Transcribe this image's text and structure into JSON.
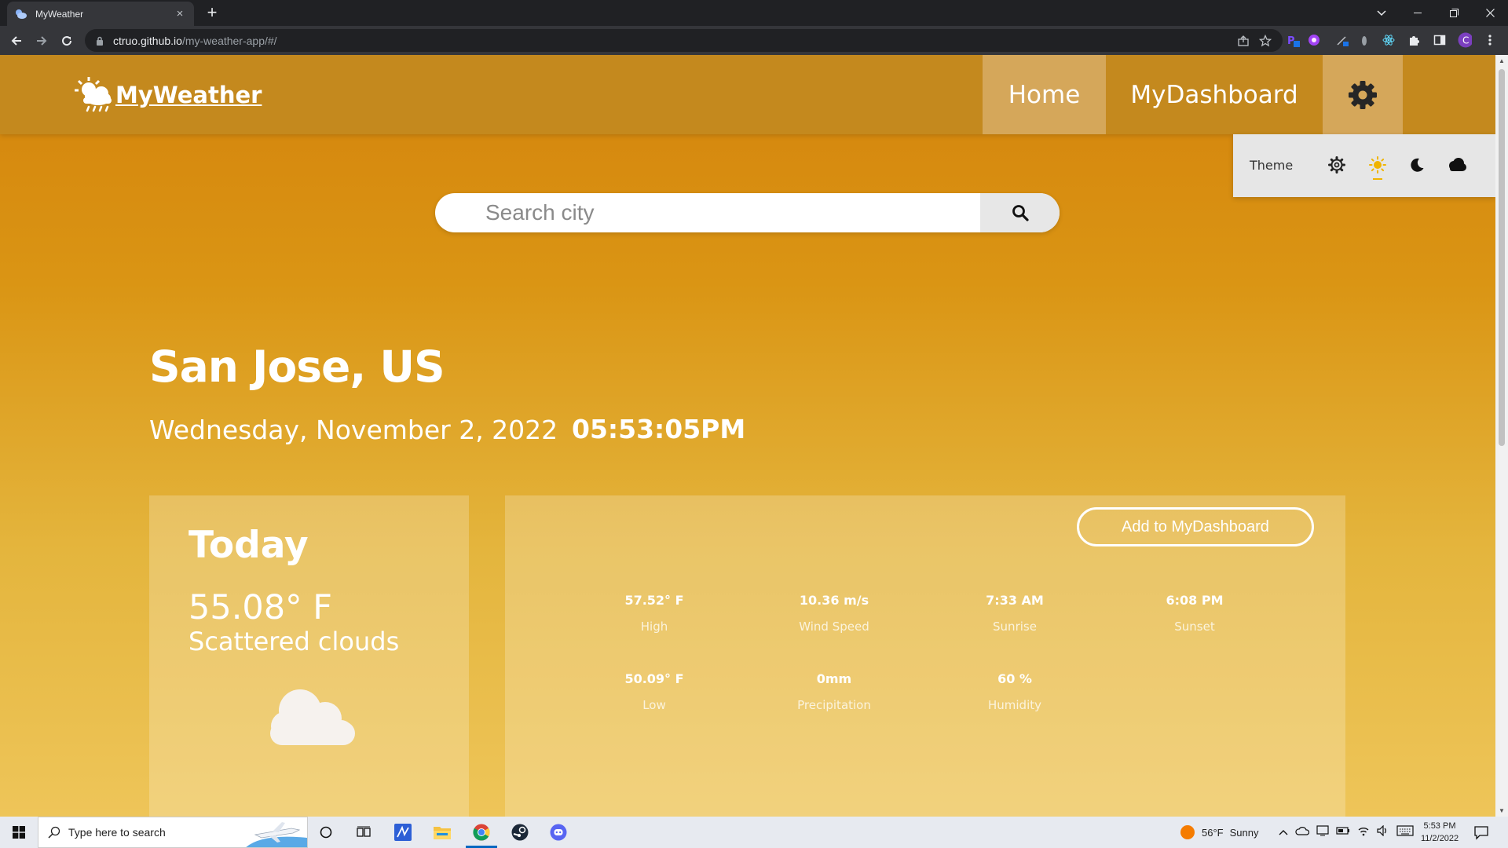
{
  "browser": {
    "tab_title": "MyWeather",
    "tab_close": "×",
    "new_tab": "+",
    "url_host": "ctruo.github.io",
    "url_path": "/my-weather-app/#/"
  },
  "app": {
    "brand": "MyWeather",
    "nav": {
      "home": "Home",
      "dashboard": "MyDashboard"
    },
    "theme": {
      "label": "Theme",
      "selected": "light"
    },
    "search": {
      "placeholder": "Search city",
      "value": ""
    },
    "location": {
      "city": "San Jose, US",
      "date": "Wednesday, November 2, 2022",
      "time": "05:53:05PM"
    },
    "today": {
      "title": "Today",
      "temperature": "55.08° F",
      "description": "Scattered clouds",
      "icon": "cloud-icon"
    },
    "add_button": "Add to MyDashboard",
    "stats": [
      {
        "value": "57.52° F",
        "label": "High"
      },
      {
        "value": "10.36 m/s",
        "label": "Wind Speed"
      },
      {
        "value": "7:33 AM",
        "label": "Sunrise"
      },
      {
        "value": "6:08 PM",
        "label": "Sunset"
      },
      {
        "value": "50.09° F",
        "label": "Low"
      },
      {
        "value": "0mm",
        "label": "Precipitation"
      },
      {
        "value": "60 %",
        "label": "Humidity"
      }
    ],
    "colors": {
      "navbar": "#c4891e",
      "accent_sun": "#f0b400"
    }
  },
  "taskbar": {
    "search_placeholder": "Type here to search",
    "weather_temp": "56°F",
    "weather_text": "Sunny",
    "clock_time": "5:53 PM",
    "clock_date": "11/2/2022"
  }
}
